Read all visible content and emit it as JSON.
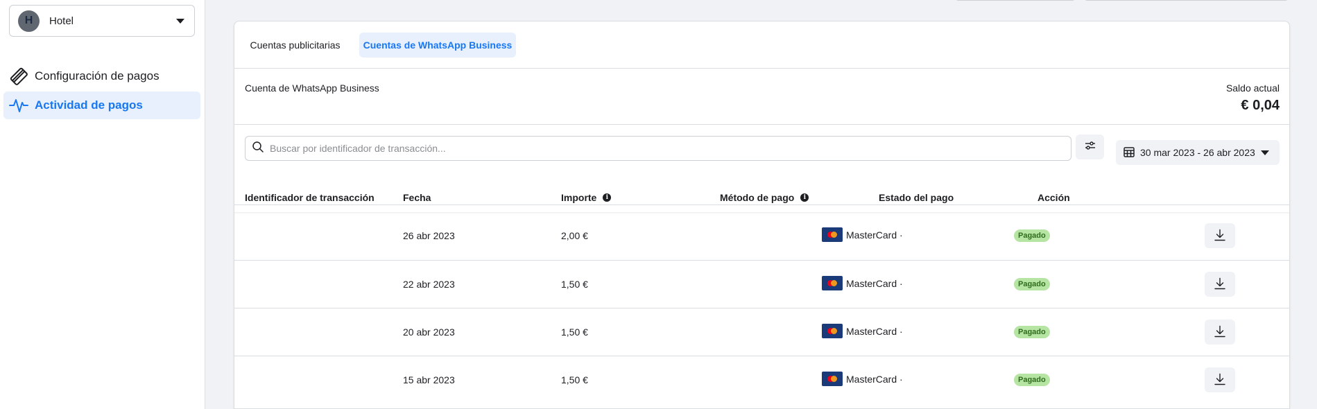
{
  "sidebar": {
    "account": {
      "initial": "H",
      "name": "Hotel"
    },
    "nav": [
      {
        "label": "Configuración de pagos",
        "icon": "card-icon",
        "active": false
      },
      {
        "label": "Actividad de pagos",
        "icon": "activity-icon",
        "active": true
      }
    ]
  },
  "tabs": [
    {
      "label": "Cuentas publicitarias",
      "active": false
    },
    {
      "label": "Cuentas de WhatsApp Business",
      "active": true
    }
  ],
  "account_row": {
    "label": "Cuenta de WhatsApp Business",
    "balance_label": "Saldo actual",
    "balance_value": "€ 0,04"
  },
  "search": {
    "placeholder": "Buscar por identificador de transacción...",
    "value": ""
  },
  "date_range": "30 mar 2023 - 26 abr 2023",
  "table": {
    "headers": {
      "id": "Identificador de transacción",
      "date": "Fecha",
      "amount": "Importe",
      "method": "Método de pago",
      "status": "Estado del pago",
      "action": "Acción"
    },
    "rows": [
      {
        "id": "",
        "date": "26 abr 2023",
        "amount": "2,00 €",
        "method": "MasterCard ·",
        "status": "Pagado"
      },
      {
        "id": "",
        "date": "22 abr 2023",
        "amount": "1,50 €",
        "method": "MasterCard ·",
        "status": "Pagado"
      },
      {
        "id": "",
        "date": "20 abr 2023",
        "amount": "1,50 €",
        "method": "MasterCard ·",
        "status": "Pagado"
      },
      {
        "id": "",
        "date": "15 abr 2023",
        "amount": "1,50 €",
        "method": "MasterCard ·",
        "status": "Pagado"
      }
    ]
  },
  "colors": {
    "accent": "#1877f2",
    "accent_bg": "#e7f0fc",
    "status_bg": "#b6e5a3",
    "status_text": "#2f6b1d"
  }
}
